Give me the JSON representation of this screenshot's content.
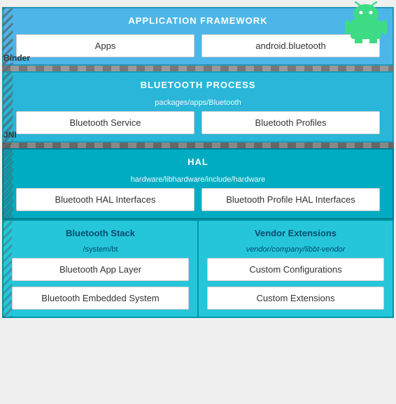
{
  "android_logo": {
    "alt": "Android Logo"
  },
  "app_framework": {
    "title": "APPLICATION FRAMEWORK",
    "cards": [
      {
        "label": "Apps"
      },
      {
        "label": "android.bluetooth"
      }
    ]
  },
  "binder": {
    "label": "Binder"
  },
  "bt_process": {
    "title": "BLUETOOTH PROCESS",
    "subtitle": "packages/apps/Bluetooth",
    "cards": [
      {
        "label": "Bluetooth Service"
      },
      {
        "label": "Bluetooth Profiles"
      }
    ]
  },
  "jni": {
    "label": "JNI"
  },
  "hal": {
    "title": "HAL",
    "subtitle": "hardware/libhardware/include/hardware",
    "cards": [
      {
        "label": "Bluetooth HAL Interfaces"
      },
      {
        "label": "Bluetooth Profile HAL Interfaces"
      }
    ]
  },
  "bt_stack": {
    "title": "Bluetooth Stack",
    "subtitle": "/system/bt",
    "cards": [
      {
        "label": "Bluetooth App Layer"
      },
      {
        "label": "Bluetooth Embedded System"
      }
    ]
  },
  "vendor_ext": {
    "title": "Vendor Extensions",
    "subtitle": "vendor/company/libbt-vendor",
    "cards": [
      {
        "label": "Custom Configurations"
      },
      {
        "label": "Custom Extensions"
      }
    ]
  },
  "icons": {
    "android_green": "#3ddc84"
  }
}
